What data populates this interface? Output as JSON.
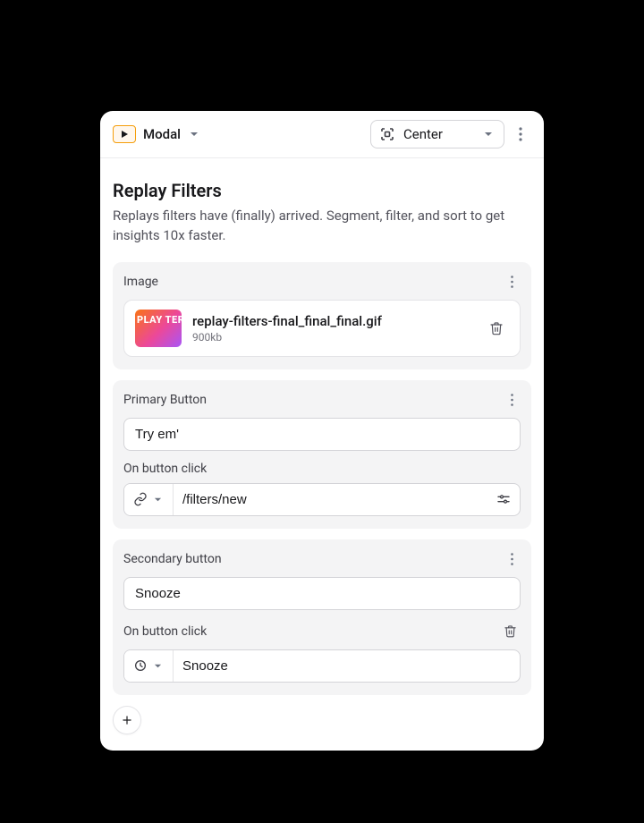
{
  "header": {
    "type_label": "Modal",
    "position_label": "Center"
  },
  "page": {
    "title": "Replay Filters",
    "subtitle": "Replays filters have (finally) arrived. Segment, filter, and sort to get insights 10x faster."
  },
  "image_section": {
    "label": "Image",
    "file_name": "replay-filters-final_final_final.gif",
    "file_size": "900kb"
  },
  "primary_button": {
    "label": "Primary Button",
    "value": "Try em'",
    "on_click_label": "On button click",
    "on_click_value": "/filters/new"
  },
  "secondary_button": {
    "label": "Secondary button",
    "value": "Snooze",
    "on_click_label": "On button click",
    "on_click_value": "Snooze"
  }
}
